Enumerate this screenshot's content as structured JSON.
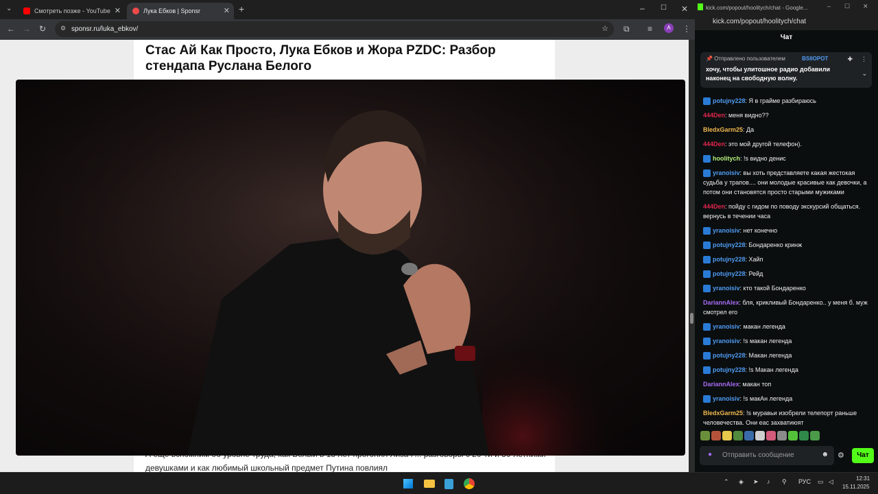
{
  "browser": {
    "tabs": [
      {
        "label": "Смотреть позже - YouTube",
        "favicon_color": "#ff0000"
      },
      {
        "label": "Лука Ебков | Sponsr",
        "favicon_color": "#f04a4a"
      }
    ],
    "new_tab_label": "+",
    "url": "sponsr.ru/luka_ebkov/"
  },
  "article": {
    "title": "Стас Ай Как Просто, Лука Ебков и Жора PZDC: Разбор стендапа Руслана Белого",
    "body_visible": "А еще вспомним об уровне труда, как Белый в 18 лет прогонял Лиза Р... разговоры с 20-ти и 30-летними девушками и как любимый школьный предмет Путина повлиял"
  },
  "chat_window": {
    "window_title": "kick.com/popout/hoolitych/chat - Google...",
    "url": "kick.com/popout/hoolitych/chat",
    "header": "Чат",
    "pinned": {
      "label": "Отправлено пользователем",
      "user": "BSIIOPOT",
      "text": "хочу, чтобы улитошное радио добавили наконец на свободную волну."
    },
    "messages": [
      {
        "user": "potujny228",
        "color": "#4f9cf3",
        "badge": true,
        "text": "Я в грайме разбираюсь"
      },
      {
        "user": "444Den",
        "color": "#e0264c",
        "badge": false,
        "text": "меня видно??"
      },
      {
        "user": "BledxGarm25",
        "color": "#f0b84f",
        "badge": false,
        "text": "Да"
      },
      {
        "user": "444Den",
        "color": "#e0264c",
        "badge": false,
        "text": "это мой другой телефон)."
      },
      {
        "user": "hoolitych",
        "color": "#b5f07a",
        "badge": true,
        "text": "!s видно денис"
      },
      {
        "user": "yranoisiv",
        "color": "#4f9cf3",
        "badge": true,
        "text": "вы хоть представляете какая жестокая судьба у трапов.... они молодые красивые как девочки, а потом они становятся просто старыми мужиками"
      },
      {
        "user": "444Den",
        "color": "#e0264c",
        "badge": false,
        "text": "пойду с гидом по поводу экскурсий общаться. вернусь в течении часа"
      },
      {
        "user": "yranoisiv",
        "color": "#4f9cf3",
        "badge": true,
        "text": "нет конечно"
      },
      {
        "user": "potujny228",
        "color": "#4f9cf3",
        "badge": true,
        "text": "Бондаренко кринж"
      },
      {
        "user": "potujny228",
        "color": "#4f9cf3",
        "badge": true,
        "text": "Хайп"
      },
      {
        "user": "potujny228",
        "color": "#4f9cf3",
        "badge": true,
        "text": "Рейд"
      },
      {
        "user": "yranoisiv",
        "color": "#4f9cf3",
        "badge": true,
        "text": "кто такой Бондаренко"
      },
      {
        "user": "DariannAlex",
        "color": "#a66bf2",
        "badge": false,
        "text": "бля, крикливый Бондаренко.. у меня б. муж смотрел его"
      },
      {
        "user": "yranoisiv",
        "color": "#4f9cf3",
        "badge": true,
        "text": "макан легенда"
      },
      {
        "user": "yranoisiv",
        "color": "#4f9cf3",
        "badge": true,
        "text": "!s макан легенда"
      },
      {
        "user": "potujny228",
        "color": "#4f9cf3",
        "badge": true,
        "text": "Макан легенда"
      },
      {
        "user": "potujny228",
        "color": "#4f9cf3",
        "badge": true,
        "text": "!s Макан легенда"
      },
      {
        "user": "DariannAlex",
        "color": "#a66bf2",
        "badge": false,
        "text": "макан топ"
      },
      {
        "user": "yranoisiv",
        "color": "#4f9cf3",
        "badge": true,
        "text": "!s макАн легенда"
      },
      {
        "user": "BledxGarm25",
        "color": "#f0b84f",
        "badge": false,
        "text": "!s муравьи изобрели телепорт раньше человечества. Они еас захватиюят"
      }
    ],
    "input_placeholder": "Отправить сообщение",
    "send_label": "Чат",
    "accent": "#53fc18"
  },
  "taskbar": {
    "lang": "РУС",
    "time": "12:31",
    "date": "15.11.2025"
  }
}
